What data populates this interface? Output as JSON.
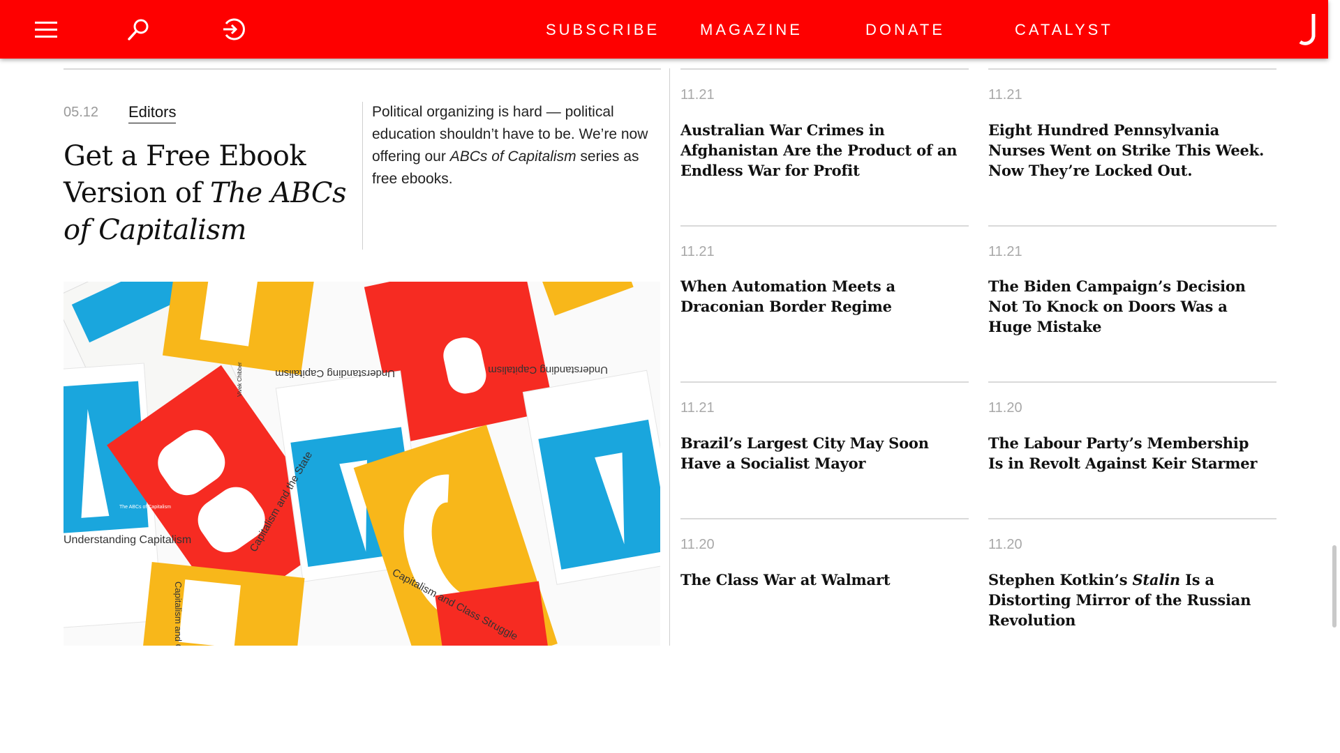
{
  "nav": {
    "items": [
      "SUBSCRIBE",
      "MAGAZINE",
      "DONATE",
      "CATALYST"
    ],
    "brand_color": "#fe0000"
  },
  "featured": {
    "date": "05.12",
    "author": "Editors",
    "title_plain": "Get a Free Ebook Version of ",
    "title_em": "The ABCs of Capitalism",
    "dek_before": "Political organizing is hard — political education shouldn’t have to be. We’re now offering our ",
    "dek_em": "ABCs of Capitalism",
    "dek_after": " series as free ebooks."
  },
  "image_text": {
    "book_title_1": "Understanding Capitalism",
    "book_title_2": "Capitalism and the State",
    "book_title_3": "Capitalism and Class Struggle",
    "series": "The ABCs of Capitalism",
    "author_name": "Vivek Chibber"
  },
  "articles": [
    {
      "date": "11.21",
      "title": "Australian War Crimes in Afghanistan Are the Product of an Endless War for Profit"
    },
    {
      "date": "11.21",
      "title": "Eight Hundred Pennsylvania Nurses Went on Strike This Week. Now They’re Locked Out."
    },
    {
      "date": "11.21",
      "title": "When Automation Meets a Draconian Border Regime"
    },
    {
      "date": "11.21",
      "title": "The Biden Campaign’s Decision Not To Knock on Doors Was a Huge Mistake"
    },
    {
      "date": "11.21",
      "title": "Brazil’s Largest City May Soon Have a Socialist Mayor"
    },
    {
      "date": "11.20",
      "title": "The Labour Party’s Membership Is in Revolt Against Keir Starmer"
    },
    {
      "date": "11.20",
      "title": "The Class War at Walmart"
    },
    {
      "date": "11.20",
      "title_before": "Stephen Kotkin’s ",
      "title_em": "Stalin",
      "title_after": " Is a Distorting Mirror of the Russian Revolution"
    }
  ]
}
